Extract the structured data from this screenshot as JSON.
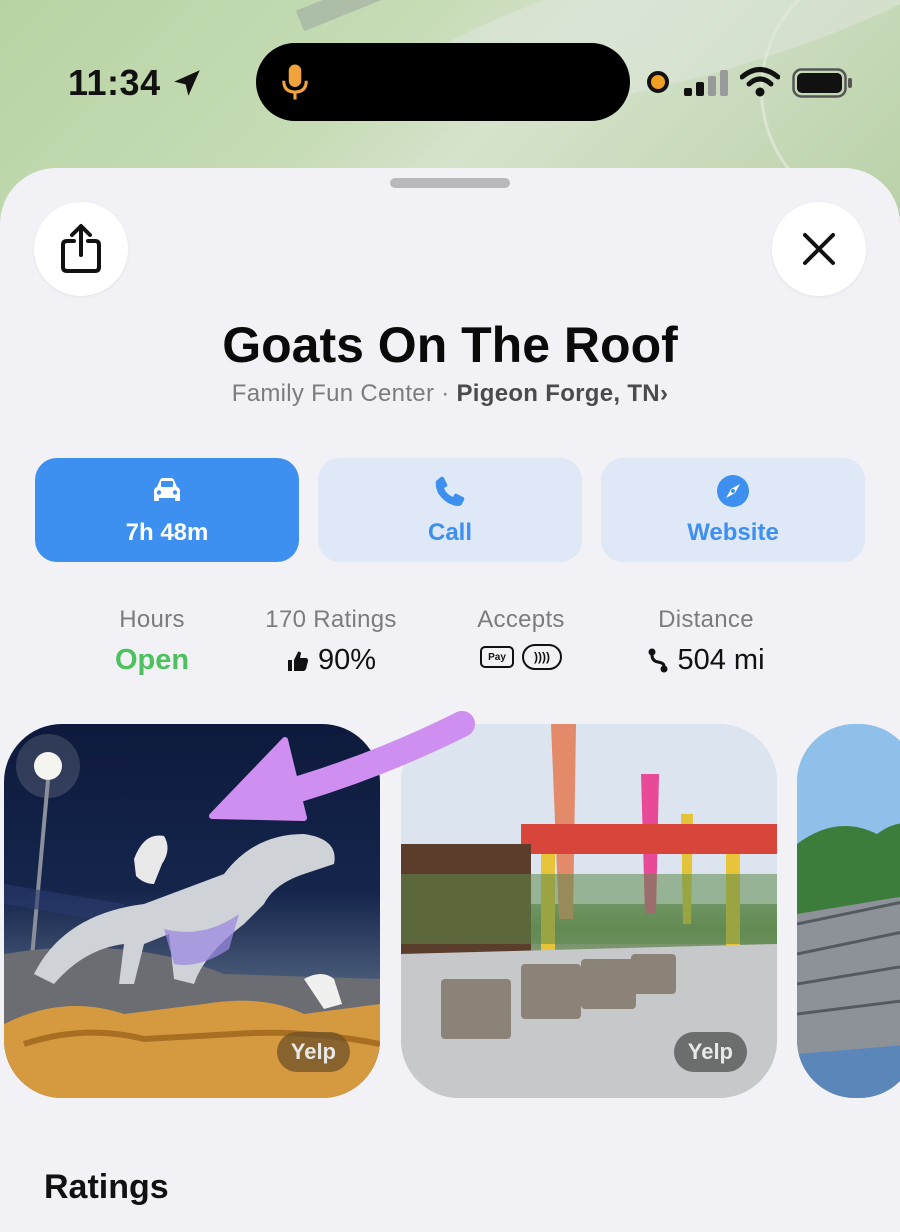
{
  "status_bar": {
    "time": "11:34"
  },
  "place": {
    "name": "Goats On The Roof",
    "category": "Family Fun Center · ",
    "location": "Pigeon Forge, TN",
    "location_chevron": "›"
  },
  "actions": {
    "drive_label": "7h 48m",
    "call_label": "Call",
    "website_label": "Website"
  },
  "stats": {
    "hours_label": "Hours",
    "hours_value": "Open",
    "ratings_label": "170 Ratings",
    "ratings_value": "90%",
    "accepts_label": "Accepts",
    "apple_pay_badge": "Pay",
    "nfc_badge": "))))",
    "distance_label": "Distance",
    "distance_value": "504 mi"
  },
  "photos": [
    {
      "source": "Yelp"
    },
    {
      "source": "Yelp"
    }
  ],
  "sections": {
    "ratings_title": "Ratings"
  },
  "colors": {
    "accent": "#3d8ff0",
    "open_green": "#4cc15e",
    "annotation_arrow": "#cf8ff0"
  }
}
